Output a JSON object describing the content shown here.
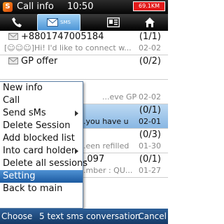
{
  "status": {
    "app_logo": "S",
    "title": "Call info",
    "time": "10:50",
    "battery": "69.1KM"
  },
  "tabs": [
    {
      "name": "phone",
      "icon": "phone-icon"
    },
    {
      "name": "sms",
      "label": "SMS",
      "icon": "envelope-icon"
    },
    {
      "name": "card",
      "icon": "contact-card-icon"
    },
    {
      "name": "home",
      "icon": "home-icon"
    }
  ],
  "rows": [
    {
      "title": "+8801747005184",
      "count": "(1/1)",
      "preview": "[☺☺☺]Hi! I'd like to connect w...",
      "date": "02-02"
    },
    {
      "title": "GP offer",
      "count": "(0/2)",
      "preview": "",
      "date": ""
    },
    {
      "title": "",
      "count": "",
      "preview": "...eve GP-G",
      "date": "02-02"
    },
    {
      "title": "",
      "count": "(0/1)",
      "preview": "...you have u",
      "date": "02-01"
    },
    {
      "title": "",
      "count": "(0/3)",
      "preview": "...een refilled",
      "date": "01-30"
    },
    {
      "title": "...097",
      "count": "(0/1)",
      "preview": "...mber : QU...",
      "date": "01-27"
    }
  ],
  "menu": {
    "items": [
      {
        "label": "New info"
      },
      {
        "label": "Call"
      },
      {
        "label": "Send sMs",
        "submenu": true
      },
      {
        "label": "Delete Session"
      },
      {
        "label": "Add blocked list"
      },
      {
        "label": "Into card holder",
        "submenu": true
      },
      {
        "label": "Delete all sessions"
      },
      {
        "label": "Setting",
        "selected": true
      },
      {
        "label": "Back to main"
      }
    ]
  },
  "softkeys": {
    "left": "Choose",
    "center": "5 text sms conversation",
    "right": "Cancel"
  },
  "colors": {
    "accent": "#1c5aa0",
    "selected_row": "#88b7e3",
    "battery": "#e21a1a",
    "softbar": "#153a66"
  }
}
